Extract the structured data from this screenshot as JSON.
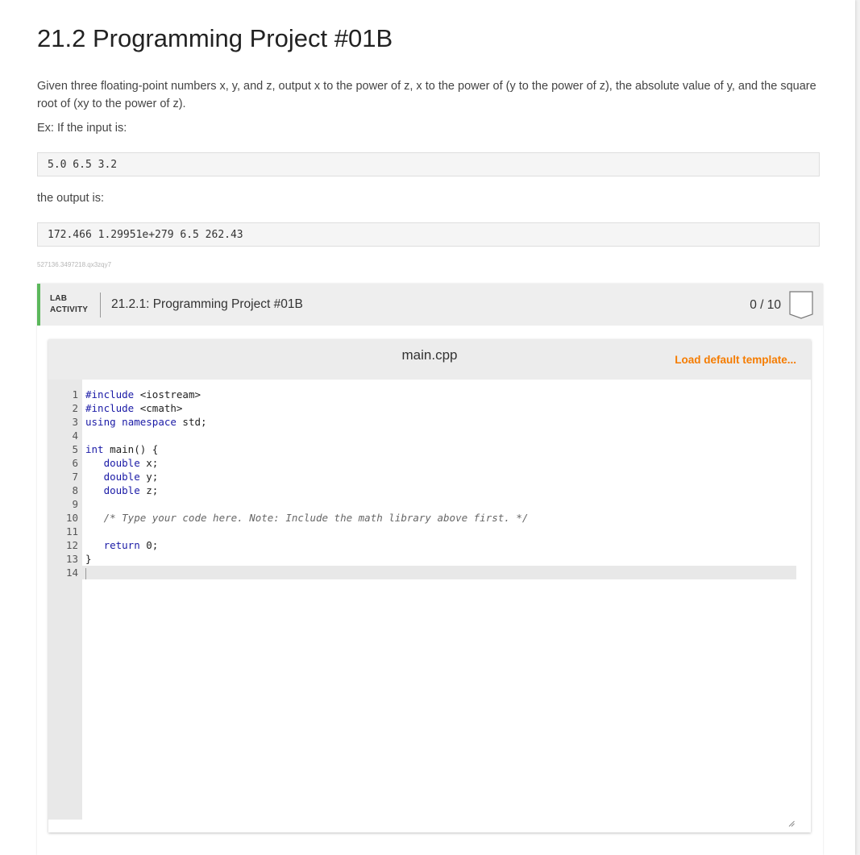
{
  "page": {
    "title": "21.2 Programming Project #01B",
    "description": "Given three floating-point numbers x, y, and z, output x to the power of z, x to the power of (y to the power of z), the absolute value of y, and the square root of (xy to the power of z).",
    "example_label": "Ex: If the input is:",
    "example_input": "5.0 6.5 3.2",
    "output_label": "the output is:",
    "example_output": "172.466 1.29951e+279 6.5 262.43",
    "code_id": "527136.3497218.qx3zqy7"
  },
  "lab": {
    "label_line1": "LAB",
    "label_line2": "ACTIVITY",
    "title": "21.2.1: Programming Project #01B",
    "score": "0 / 10",
    "accent_color": "#5cb85c"
  },
  "editor": {
    "filename": "main.cpp",
    "load_template_label": "Load default template...",
    "load_color": "#f57c00",
    "lines": [
      {
        "n": "1",
        "code": "#include <iostream>"
      },
      {
        "n": "2",
        "code": "#include <cmath>"
      },
      {
        "n": "3",
        "code": "using namespace std;"
      },
      {
        "n": "4",
        "code": ""
      },
      {
        "n": "5",
        "code": "int main() {"
      },
      {
        "n": "6",
        "code": "   double x;"
      },
      {
        "n": "7",
        "code": "   double y;"
      },
      {
        "n": "8",
        "code": "   double z;"
      },
      {
        "n": "9",
        "code": ""
      },
      {
        "n": "10",
        "code": "   /* Type your code here. Note: Include the math library above first. */"
      },
      {
        "n": "11",
        "code": ""
      },
      {
        "n": "12",
        "code": "   return 0;"
      },
      {
        "n": "13",
        "code": "}"
      },
      {
        "n": "14",
        "code": ""
      }
    ]
  }
}
